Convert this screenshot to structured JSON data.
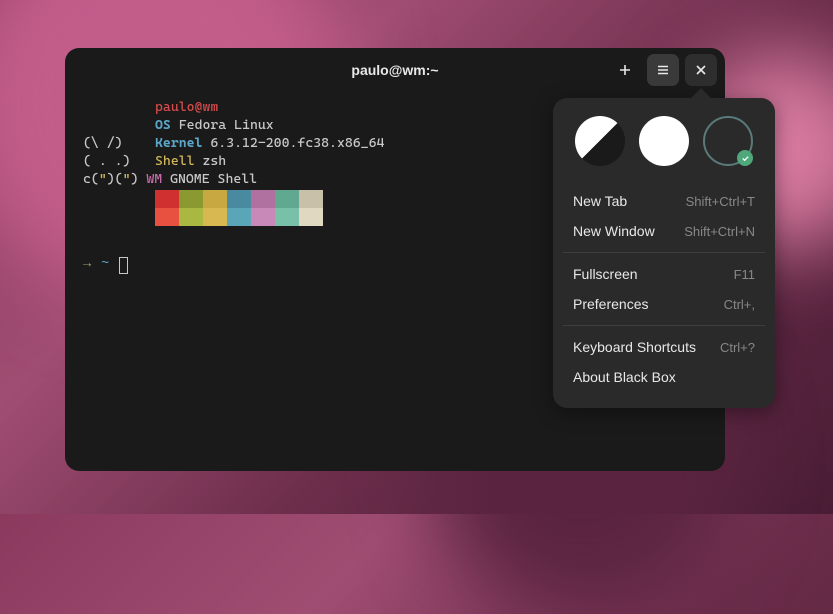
{
  "titlebar": {
    "title": "paulo@wm:~"
  },
  "fetch": {
    "user_host": "paulo@wm",
    "os_label": "OS",
    "os_value": "Fedora Linux",
    "kernel_label": "Kernel",
    "kernel_value": "6.3.12-200.fc38.x86_64",
    "shell_label": "Shell",
    "shell_value": "zsh",
    "wm_label": "WM",
    "wm_value": "GNOME Shell",
    "ascii": {
      "l1": "        ",
      "l2": "        ",
      "l3": "(\\ /)   ",
      "l4": "( . .)  ",
      "l5_a": "c(",
      "l5_q1": "\"",
      "l5_b": ")(",
      "l5_q2": "\"",
      "l5_c": ") "
    },
    "swatches_row1": [
      "#d03030",
      "#8a9a30",
      "#c8a840",
      "#4a8aa0",
      "#b070a0",
      "#60a890",
      "#c8c0a8"
    ],
    "swatches_row2": [
      "#e85040",
      "#a8b840",
      "#d8b850",
      "#5aa5b8",
      "#c888b8",
      "#78c0a8",
      "#e0d8c0"
    ]
  },
  "prompt": {
    "arrow": "→",
    "cwd": "~"
  },
  "popover": {
    "themes": [
      {
        "name": "follow-system",
        "kind": "half",
        "selected": false
      },
      {
        "name": "light",
        "kind": "white",
        "selected": false
      },
      {
        "name": "dark",
        "kind": "ring",
        "selected": true
      }
    ],
    "sections": [
      [
        {
          "label": "New Tab",
          "accel": "Shift+Ctrl+T"
        },
        {
          "label": "New Window",
          "accel": "Shift+Ctrl+N"
        }
      ],
      [
        {
          "label": "Fullscreen",
          "accel": "F11"
        },
        {
          "label": "Preferences",
          "accel": "Ctrl+,"
        }
      ],
      [
        {
          "label": "Keyboard Shortcuts",
          "accel": "Ctrl+?"
        },
        {
          "label": "About Black Box",
          "accel": ""
        }
      ]
    ]
  }
}
